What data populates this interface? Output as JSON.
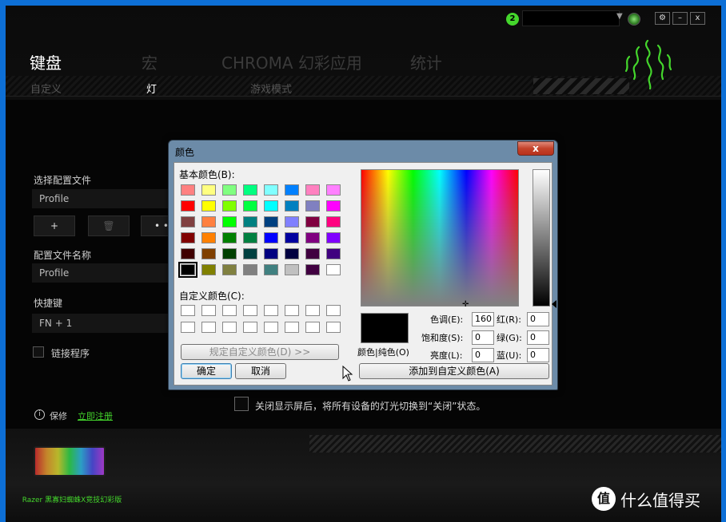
{
  "header": {
    "notification_count": "2",
    "main_tabs": [
      "键盘",
      "宏",
      "CHROMA 幻彩应用",
      "统计"
    ],
    "sub_tabs": [
      "自定义",
      "灯",
      "游戏模式"
    ],
    "window_buttons": [
      "⚙",
      "–",
      "x"
    ]
  },
  "left_panel": {
    "select_profile_label": "选择配置文件",
    "profile_value": "Profile",
    "add_button": "+",
    "delete_button": "🗑",
    "more_button": "• •",
    "profile_name_label": "配置文件名称",
    "profile_name_value": "Profile",
    "hotkey_label": "快捷键",
    "hotkey_value": "FN + 1",
    "link_program_label": "链接程序",
    "save_text": "保修",
    "register_link": "立即注册"
  },
  "bottom": {
    "close_notice": "关闭显示屏后，将所有设备的灯光切换到“关闭”状态。",
    "device_label": "Razer 黑寡妇蜘蛛X竞技幻彩版",
    "watermark_text": "什么值得买",
    "watermark_icon": "值"
  },
  "dialog": {
    "title": "颜色",
    "close_label": "x",
    "basic_colors_label": "基本颜色(B):",
    "custom_colors_label": "自定义颜色(C):",
    "define_custom_button": "规定自定义颜色(D) >>",
    "ok_button": "确定",
    "cancel_button": "取消",
    "preview_label": "颜色|纯色(O)",
    "add_custom_button": "添加到自定义颜色(A)",
    "hue_label": "色调(E):",
    "hue_value": "160",
    "sat_label": "饱和度(S):",
    "sat_value": "0",
    "lum_label": "亮度(L):",
    "lum_value": "0",
    "red_label": "红(R):",
    "red_value": "0",
    "green_label": "绿(G):",
    "green_value": "0",
    "blue_label": "蓝(U):",
    "blue_value": "0",
    "basic_colors": [
      [
        "#ff8080",
        "#ffff80",
        "#80ff80",
        "#00ff80",
        "#80ffff",
        "#0080ff",
        "#ff80c0",
        "#ff80ff"
      ],
      [
        "#ff0000",
        "#ffff00",
        "#80ff00",
        "#00ff40",
        "#00ffff",
        "#0080c0",
        "#8080c0",
        "#ff00ff"
      ],
      [
        "#804040",
        "#ff8040",
        "#00ff00",
        "#008080",
        "#004080",
        "#8080ff",
        "#800040",
        "#ff0080"
      ],
      [
        "#800000",
        "#ff8000",
        "#008000",
        "#008040",
        "#0000ff",
        "#0000a0",
        "#800080",
        "#8000ff"
      ],
      [
        "#400000",
        "#804000",
        "#004000",
        "#004040",
        "#000080",
        "#000040",
        "#400040",
        "#400080"
      ],
      [
        "#000000",
        "#808000",
        "#808040",
        "#808080",
        "#408080",
        "#c0c0c0",
        "#400040",
        "#ffffff"
      ]
    ]
  }
}
